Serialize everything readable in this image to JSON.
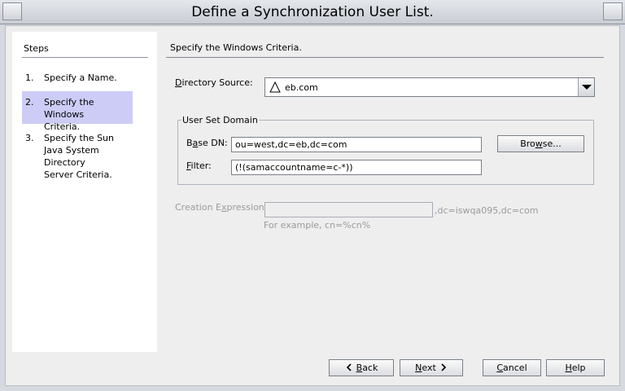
{
  "window": {
    "title": "Define a Synchronization User List."
  },
  "steps": {
    "title": "Steps",
    "items": [
      {
        "num": "1.",
        "label": "Specify a Name."
      },
      {
        "num": "2.",
        "label": "Specify the Windows Criteria."
      },
      {
        "num": "3.",
        "label": "Specify the Sun Java System Directory Server Criteria."
      }
    ]
  },
  "main": {
    "heading": "Specify the Windows Criteria.",
    "directory_source": {
      "label_u": "D",
      "label_rest": "irectory Source:",
      "value": "eb.com",
      "icon": "warning-triangle-icon"
    },
    "user_set_domain": {
      "title": "User Set Domain",
      "base_dn": {
        "label_pre": "B",
        "label_u": "a",
        "label_rest": "se DN:",
        "value": "ou=west,dc=eb,dc=com"
      },
      "filter": {
        "label_u": "F",
        "label_rest": "ilter:",
        "value": "(!(samaccountname=c-*))"
      },
      "browse": {
        "pre": "Bro",
        "u": "w",
        "rest": "se..."
      }
    },
    "creation_expression": {
      "label_pre": "Creation E",
      "label_u": "x",
      "label_rest": "pression:",
      "value": "",
      "suffix": ",dc=iswqa095,dc=com",
      "example": "For example, cn=%cn%"
    }
  },
  "buttons": {
    "back": {
      "u": "B",
      "rest": "ack"
    },
    "next": {
      "u": "N",
      "rest": "ext"
    },
    "cancel": {
      "u": "C",
      "rest": "ancel"
    },
    "help": {
      "u": "H",
      "rest": "elp"
    }
  }
}
